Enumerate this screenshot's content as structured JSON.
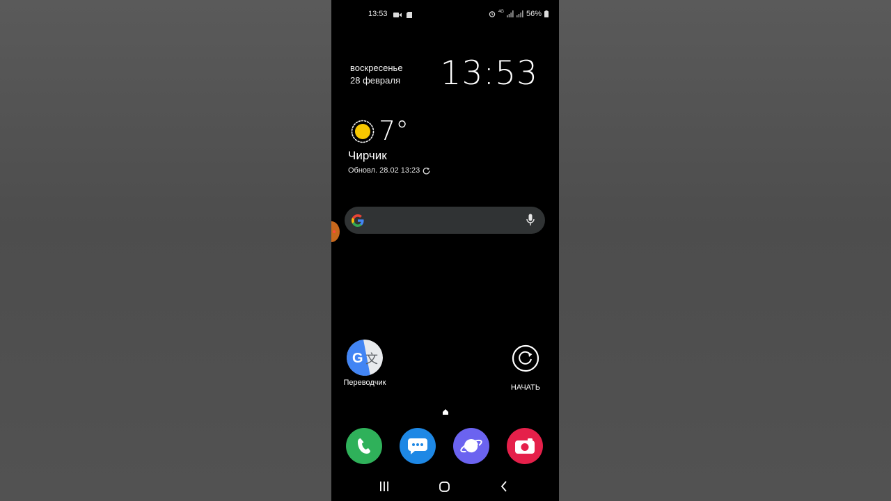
{
  "status_bar": {
    "time": "13:53",
    "battery": "56%",
    "network": "4G"
  },
  "clock_widget": {
    "day": "воскресенье",
    "date": "28 февраля",
    "time": "13:53"
  },
  "weather": {
    "temperature": "7°",
    "city": "Чирчик",
    "updated": "Обновл. 28.02 13:23",
    "icon": "sun-icon"
  },
  "search": {
    "logo": "google-g-icon",
    "mic": "microphone-icon"
  },
  "apps": [
    {
      "label": "Переводчик",
      "icon": "google-translate-icon"
    },
    {
      "label": "НАЧАТЬ",
      "icon": "refresh-start-icon"
    }
  ],
  "dock": [
    {
      "name": "phone",
      "icon": "phone-icon",
      "color": "#2fb15a"
    },
    {
      "name": "messages",
      "icon": "chat-bubble-icon",
      "color": "#1e88e5"
    },
    {
      "name": "internet",
      "icon": "planet-icon",
      "color": "#6b63f0"
    },
    {
      "name": "camera",
      "icon": "camera-icon",
      "color": "#e5204a"
    }
  ],
  "nav": {
    "recent": "recent-apps-icon",
    "home": "home-icon",
    "back": "back-icon"
  }
}
